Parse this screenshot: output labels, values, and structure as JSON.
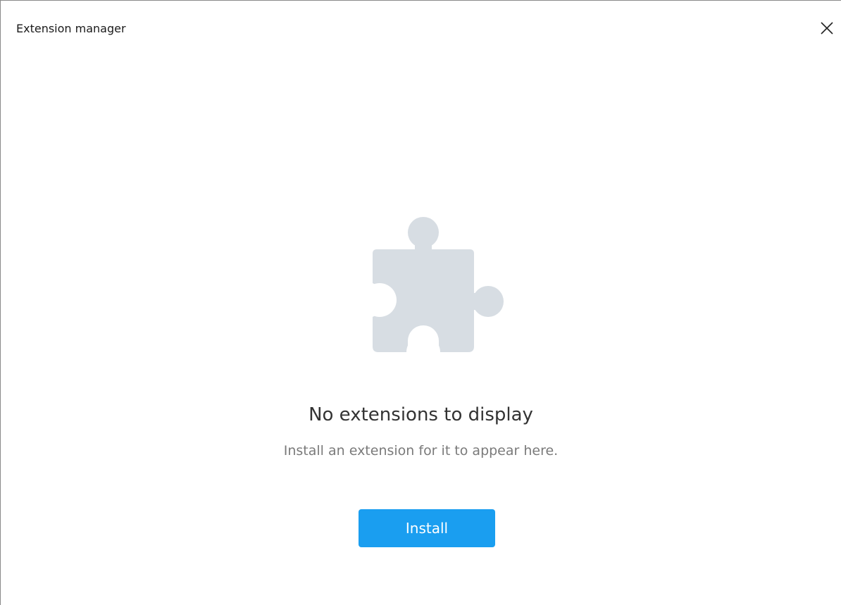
{
  "window": {
    "title": "Extension manager"
  },
  "icons": {
    "close": "close-icon",
    "empty": "puzzle-piece-icon"
  },
  "empty_state": {
    "heading": "No extensions to display",
    "subtext": "Install an extension for it to appear here.",
    "install_label": "Install"
  },
  "colors": {
    "accent": "#1a9ef0",
    "puzzle": "#d7dde3"
  }
}
